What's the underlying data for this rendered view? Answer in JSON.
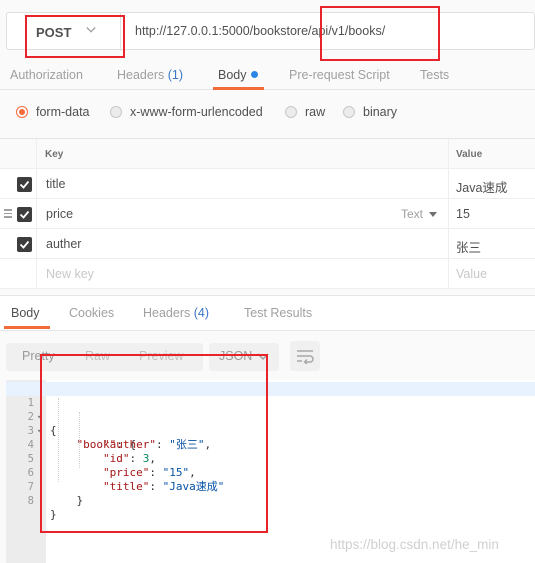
{
  "request": {
    "method": "POST",
    "url": "http://127.0.0.1:5000/bookstore/api/v1/books/"
  },
  "request_tabs": [
    {
      "label": "Authorization",
      "count": "",
      "dot": false,
      "active": false
    },
    {
      "label": "Headers",
      "count": "(1)",
      "dot": false,
      "active": false
    },
    {
      "label": "Body",
      "count": "",
      "dot": true,
      "active": true
    },
    {
      "label": "Pre-request Script",
      "count": "",
      "dot": false,
      "active": false
    },
    {
      "label": "Tests",
      "count": "",
      "dot": false,
      "active": false
    }
  ],
  "body_types": [
    {
      "label": "form-data",
      "selected": true
    },
    {
      "label": "x-www-form-urlencoded",
      "selected": false
    },
    {
      "label": "raw",
      "selected": false
    },
    {
      "label": "binary",
      "selected": false
    }
  ],
  "params": {
    "header_key": "Key",
    "header_value": "Value",
    "rows": [
      {
        "checked": true,
        "key": "title",
        "value": "Java速成",
        "type": ""
      },
      {
        "checked": true,
        "key": "price",
        "value": "15",
        "type": "Text"
      },
      {
        "checked": true,
        "key": "auther",
        "value": "张三",
        "type": ""
      }
    ],
    "new_key_placeholder": "New key",
    "new_value_placeholder": "Value"
  },
  "response_tabs": [
    {
      "label": "Body",
      "count": "",
      "active": true
    },
    {
      "label": "Cookies",
      "count": "",
      "active": false
    },
    {
      "label": "Headers",
      "count": "(4)",
      "active": false
    },
    {
      "label": "Test Results",
      "count": "",
      "active": false
    }
  ],
  "view_modes": [
    "Pretty",
    "Raw",
    "Preview"
  ],
  "format": "JSON",
  "code_lines": [
    {
      "n": "1",
      "fold": "▾",
      "text": "{"
    },
    {
      "n": "2",
      "fold": "▾",
      "text": "    \"book\": {"
    },
    {
      "n": "3",
      "fold": "",
      "text": "        \"auther\": \"张三\","
    },
    {
      "n": "4",
      "fold": "",
      "text": "        \"id\": 3,"
    },
    {
      "n": "5",
      "fold": "",
      "text": "        \"price\": \"15\","
    },
    {
      "n": "6",
      "fold": "",
      "text": "        \"title\": \"Java速成\""
    },
    {
      "n": "7",
      "fold": "",
      "text": "    }"
    },
    {
      "n": "8",
      "fold": "",
      "text": "}"
    }
  ],
  "watermark": "https://blog.csdn.net/he_min",
  "colors": {
    "accent": "#f26b3a",
    "annotation_red": "#e8232a",
    "json_key": "#a31515",
    "json_string": "#0451a5",
    "json_number": "#09885a"
  }
}
